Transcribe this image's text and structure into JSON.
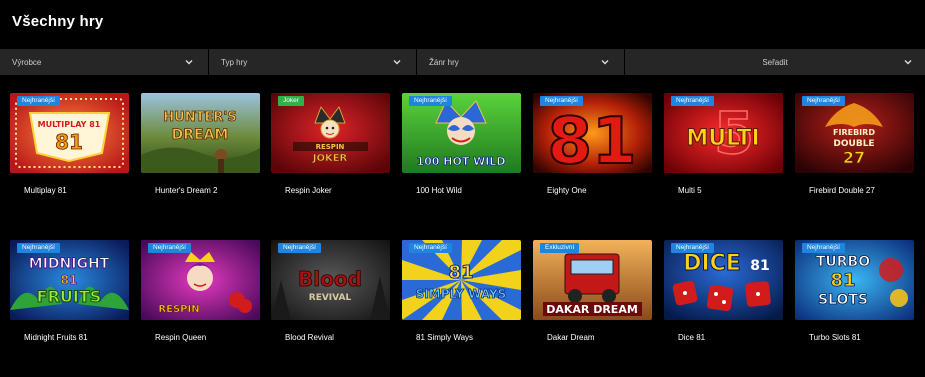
{
  "page": {
    "title": "Všechny hry"
  },
  "filters": [
    {
      "label": "Výrobce"
    },
    {
      "label": "Typ hry"
    },
    {
      "label": "Žánr hry"
    },
    {
      "label": "Seřadit"
    }
  ],
  "badge_colors": {
    "Nejhranější": "#1e86e0",
    "Joker": "#2db34a",
    "Exkluzivní": "#1e86e0"
  },
  "games": [
    {
      "name": "Multiplay 81",
      "badge": "Nejhranější",
      "logo": "MULTIPLAY 81"
    },
    {
      "name": "Hunter's Dream 2",
      "badge": "",
      "logo": "HUNTER'S DREAM"
    },
    {
      "name": "Respin Joker",
      "badge": "Joker",
      "logo": "RESPIN JOKER"
    },
    {
      "name": "100 Hot Wild",
      "badge": "Nejhranější",
      "logo": "100 HOT WILD"
    },
    {
      "name": "Eighty One",
      "badge": "Nejhranější",
      "logo": "81"
    },
    {
      "name": "Multi 5",
      "badge": "Nejhranější",
      "logo": "MULTI"
    },
    {
      "name": "Firebird Double 27",
      "badge": "Nejhranější",
      "logo": "FIREBIRD DOUBLE 27"
    },
    {
      "name": "Midnight Fruits 81",
      "badge": "Nejhranější",
      "logo": "MIDNIGHT 81 FRUITS"
    },
    {
      "name": "Respin Queen",
      "badge": "Nejhranější",
      "logo": "RESPIN"
    },
    {
      "name": "Blood Revival",
      "badge": "Nejhranější",
      "logo": "Blood REVIVAL"
    },
    {
      "name": "81 Simply Ways",
      "badge": "Nejhranější",
      "logo": "81 SIMPLY WAYS"
    },
    {
      "name": "Dakar Dream",
      "badge": "Exkluzivní",
      "logo": "DAKAR DREAM"
    },
    {
      "name": "Dice 81",
      "badge": "Nejhranější",
      "logo": "DICE 81"
    },
    {
      "name": "Turbo Slots 81",
      "badge": "Nejhranější",
      "logo": "TURBO 81 SLOTS"
    }
  ]
}
